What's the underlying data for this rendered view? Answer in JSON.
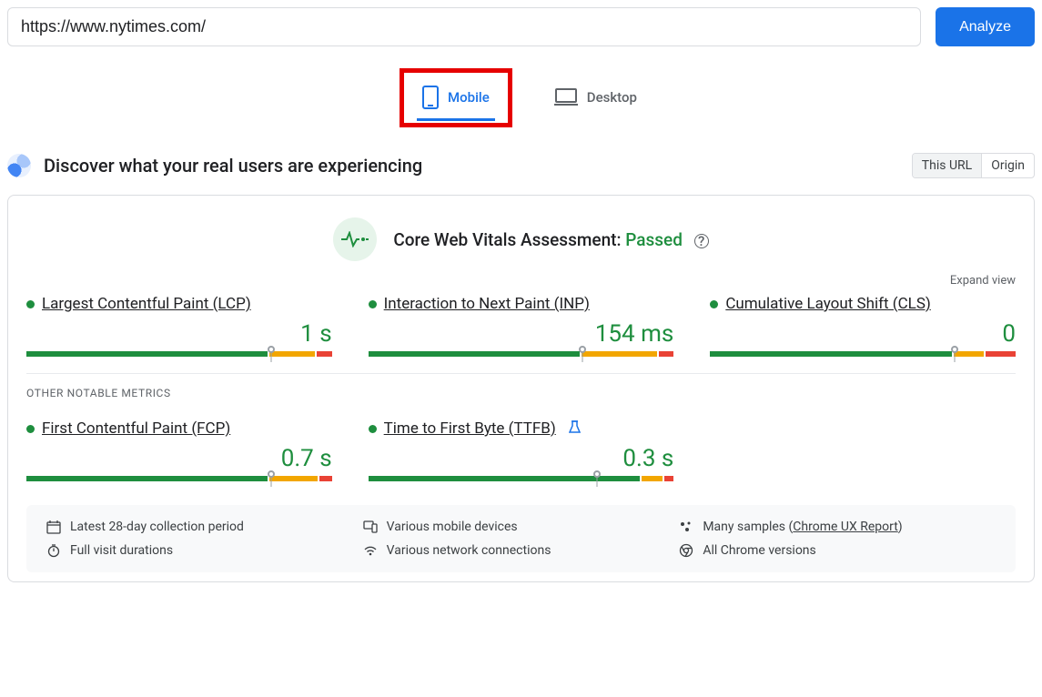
{
  "url_input": {
    "value": "https://www.nytimes.com/"
  },
  "analyze_btn": "Analyze",
  "tabs": {
    "mobile": "Mobile",
    "desktop": "Desktop",
    "active": "mobile"
  },
  "discover": {
    "title": "Discover what your real users are experiencing"
  },
  "scope_toggle": {
    "this_url": "This URL",
    "origin": "Origin",
    "active": "this_url"
  },
  "assessment": {
    "label": "Core Web Vitals Assessment: ",
    "status": "Passed"
  },
  "expand_view": "Expand view",
  "metrics": {
    "lcp": {
      "name": "Largest Contentful Paint (LCP)",
      "value": "1 s",
      "segments": [
        80,
        15,
        5
      ],
      "marker": 80
    },
    "inp": {
      "name": "Interaction to Next Paint (INP)",
      "value": "154 ms",
      "segments": [
        70,
        25,
        5
      ],
      "marker": 70
    },
    "cls": {
      "name": "Cumulative Layout Shift (CLS)",
      "value": "0",
      "segments": [
        80,
        10,
        10
      ],
      "marker": 80
    },
    "fcp": {
      "name": "First Contentful Paint (FCP)",
      "value": "0.7 s",
      "segments": [
        80,
        16,
        4
      ],
      "marker": 80
    },
    "ttfb": {
      "name": "Time to First Byte (TTFB)",
      "value": "0.3 s",
      "segments": [
        90,
        7,
        3
      ],
      "marker": 75,
      "experimental": true
    }
  },
  "other_metrics_label": "OTHER NOTABLE METRICS",
  "footer": {
    "period": "Latest 28-day collection period",
    "devices": "Various mobile devices",
    "samples_prefix": "Many samples (",
    "samples_link": "Chrome UX Report",
    "samples_suffix": ")",
    "durations": "Full visit durations",
    "network": "Various network connections",
    "versions": "All Chrome versions"
  }
}
